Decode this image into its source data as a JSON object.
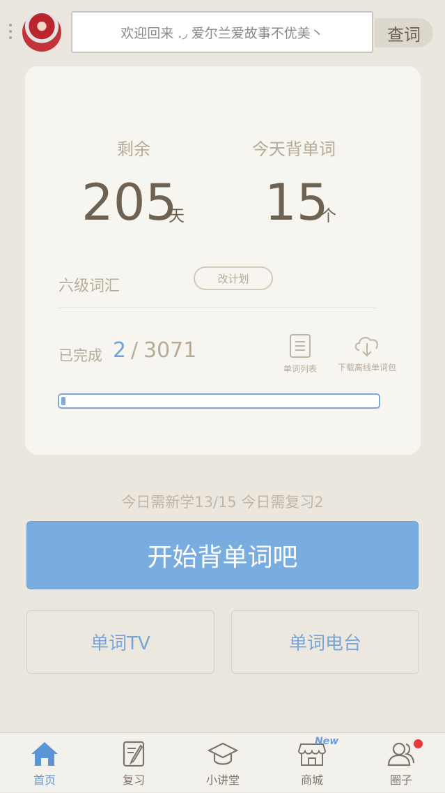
{
  "header": {
    "search_text": "欢迎回来 .◞ 爱尔兰爱故事不优美丶",
    "search_button": "查词"
  },
  "stats": {
    "remaining_label": "剩余",
    "remaining_value": "205",
    "remaining_unit": "天",
    "today_label": "今天背单词",
    "today_value": "15",
    "today_unit": "个"
  },
  "plan": {
    "name": "六级词汇",
    "change_button": "改计划"
  },
  "progress": {
    "done_label": "已完成",
    "done_count": "2",
    "slash": "/",
    "total": "3071",
    "fraction": 0.0007
  },
  "actions": {
    "word_list": "单词列表",
    "download_offline": "下载离线单词包"
  },
  "today_info": "今日需新学13/15   今日需复习2",
  "start_button": "开始背单词吧",
  "secondary": {
    "tv": "单词TV",
    "radio": "单词电台"
  },
  "tabs": [
    {
      "label": "首页",
      "icon": "home-icon",
      "active": true
    },
    {
      "label": "复习",
      "icon": "review-icon",
      "active": false
    },
    {
      "label": "小讲堂",
      "icon": "graduation-cap-icon",
      "active": false
    },
    {
      "label": "商城",
      "icon": "shop-icon",
      "active": false,
      "badge": "New"
    },
    {
      "label": "圈子",
      "icon": "people-icon",
      "active": false,
      "dot": true
    }
  ],
  "colors": {
    "accent": "#7aaddf",
    "tab_active": "#5b95d6",
    "tab_inactive": "#7e746a",
    "dot": "#e33b3b"
  }
}
